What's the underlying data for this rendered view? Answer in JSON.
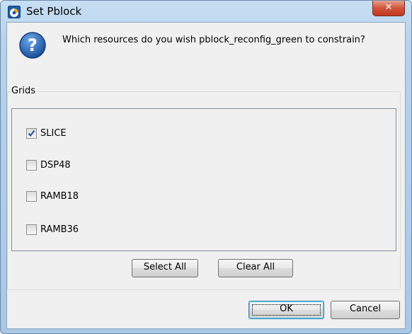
{
  "window": {
    "title": "Set Pblock",
    "close_glyph": "✕"
  },
  "message": {
    "text": "Which resources do you wish pblock_reconfig_green to constrain?",
    "icon": "question-icon"
  },
  "grids": {
    "label": "Grids",
    "items": [
      {
        "label": "SLICE",
        "checked": true
      },
      {
        "label": "DSP48",
        "checked": false
      },
      {
        "label": "RAMB18",
        "checked": false
      },
      {
        "label": "RAMB36",
        "checked": false
      }
    ],
    "select_all_label": "Select All",
    "clear_all_label": "Clear All"
  },
  "footer": {
    "ok_label": "OK",
    "cancel_label": "Cancel"
  }
}
